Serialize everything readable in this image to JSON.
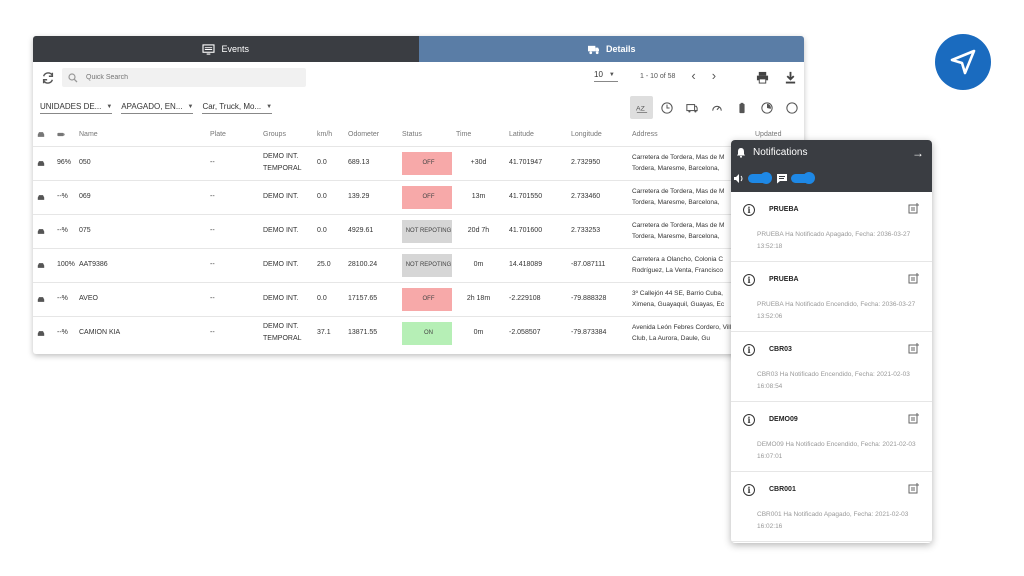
{
  "tabs": [
    {
      "label": "Events"
    },
    {
      "label": "Details"
    }
  ],
  "toolbar": {
    "search_placeholder": "Quick Search",
    "per_page": "10",
    "range": "1 - 10 of 58",
    "prev": "‹",
    "next": "›"
  },
  "filters": [
    {
      "label": "UNIDADES DE..."
    },
    {
      "label": "APAGADO, EN..."
    },
    {
      "label": "Car, Truck, Mo..."
    }
  ],
  "table": {
    "columns": [
      "Name",
      "Plate",
      "Groups",
      "km/h",
      "Odometer",
      "Status",
      "Time",
      "Latitude",
      "Longitude",
      "Address",
      "Updated"
    ],
    "rows": [
      {
        "battery": "96%",
        "name": "050",
        "plate": "--",
        "group": "DEMO INT. TEMPORAL",
        "speed": "0.0",
        "odometer": "689.13",
        "status": "OFF",
        "time": "+30d",
        "lat": "41.701947",
        "lng": "2.732950",
        "address": "Carretera de Tordera, Mas de M Tordera, Maresme, Barcelona,"
      },
      {
        "battery": "--%",
        "name": "069",
        "plate": "--",
        "group": "DEMO INT.",
        "speed": "0.0",
        "odometer": "139.29",
        "status": "OFF",
        "time": "13m",
        "lat": "41.701550",
        "lng": "2.733460",
        "address": "Carretera de Tordera, Mas de M Tordera, Maresme, Barcelona,"
      },
      {
        "battery": "--%",
        "name": "075",
        "plate": "--",
        "group": "DEMO INT.",
        "speed": "0.0",
        "odometer": "4929.61",
        "status": "NOT REPOTING",
        "time": "20d 7h",
        "lat": "41.701600",
        "lng": "2.733253",
        "address": "Carretera de Tordera, Mas de M Tordera, Maresme, Barcelona,"
      },
      {
        "battery": "100%",
        "name": "AAT9386",
        "plate": "--",
        "group": "DEMO INT.",
        "speed": "25.0",
        "odometer": "28100.24",
        "status": "NOT REPOTING",
        "time": "0m",
        "lat": "14.418089",
        "lng": "-87.087111",
        "address": "Carretera a Olancho, Colonia C Rodríguez, La Venta, Francisco"
      },
      {
        "battery": "--%",
        "name": "AVEO",
        "plate": "--",
        "group": "DEMO INT.",
        "speed": "0.0",
        "odometer": "17157.65",
        "status": "OFF",
        "time": "2h 18m",
        "lat": "-2.229108",
        "lng": "-79.888328",
        "address": "3º Callejón 44 SE, Barrio Cuba, Ximena, Guayaquil, Guayas, Ec"
      },
      {
        "battery": "--%",
        "name": "CAMION KIA",
        "plate": "--",
        "group": "DEMO INT. TEMPORAL",
        "speed": "37.1",
        "odometer": "13871.55",
        "status": "ON",
        "time": "0m",
        "lat": "-2.058507",
        "lng": "-79.873384",
        "address": "Avenida León Febres Cordero, Villa Club, La Aurora, Daule, Gu"
      }
    ]
  },
  "notifications": {
    "title": "Notifications",
    "items": [
      {
        "name": "PRUEBA",
        "message": "PRUEBA Ha Notificado Apagado, Fecha: 2036-03-27 13:52:18"
      },
      {
        "name": "PRUEBA",
        "message": "PRUEBA Ha Notificado Encendido, Fecha: 2036-03-27 13:52:06"
      },
      {
        "name": "CBR03",
        "message": "CBR03 Ha Notificado Encendido, Fecha: 2021-02-03 16:08:54"
      },
      {
        "name": "DEMO09",
        "message": "DEMO09 Ha Notificado Encendido, Fecha: 2021-02-03 16:07:01"
      },
      {
        "name": "CBR001",
        "message": "CBR001 Ha Notificado Apagado, Fecha: 2021-02-03 16:02:16"
      }
    ]
  },
  "colors": {
    "tab_dark": "#3a3d42",
    "tab_active": "#5a7da6",
    "off": "#f7a9a9",
    "on": "#b6efb6",
    "not_reporting": "#d6d6d6",
    "accent": "#1e88e5"
  }
}
